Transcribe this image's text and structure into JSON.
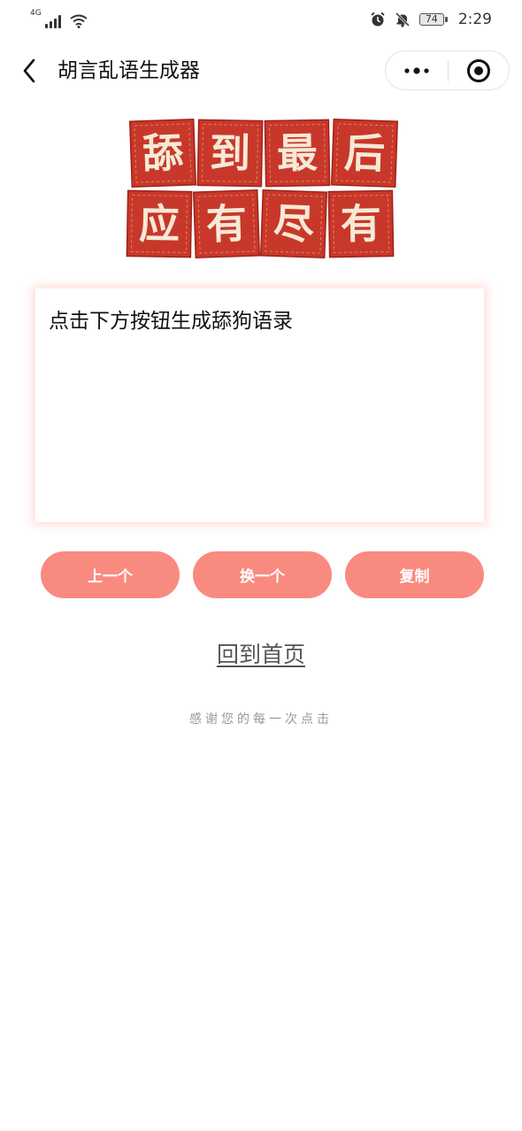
{
  "status_bar": {
    "network": "4G",
    "battery": "74",
    "time": "2:29",
    "icons": [
      "signal-icon",
      "wifi-icon",
      "alarm-icon",
      "mute-icon",
      "battery-icon"
    ]
  },
  "nav": {
    "title": "胡言乱语生成器",
    "back_icon": "chevron-left-icon",
    "more_icon": "more-dots-icon",
    "close_icon": "target-close-icon"
  },
  "banner": {
    "row1": [
      "舔",
      "到",
      "最",
      "后"
    ],
    "row2": [
      "应",
      "有",
      "尽",
      "有"
    ],
    "colors": {
      "tile": "#c8382a",
      "tile_text": "#f6e9d6"
    }
  },
  "quote": {
    "text": "点击下方按钮生成舔狗语录"
  },
  "buttons": {
    "prev": "上一个",
    "next": "换一个",
    "copy": "复制"
  },
  "home_link": "回到首页",
  "footer_text": "感谢您的每一次点击",
  "colors": {
    "button_bg": "#f98a80",
    "button_text": "#ffffff",
    "link": "#555555",
    "footer": "#999999"
  }
}
